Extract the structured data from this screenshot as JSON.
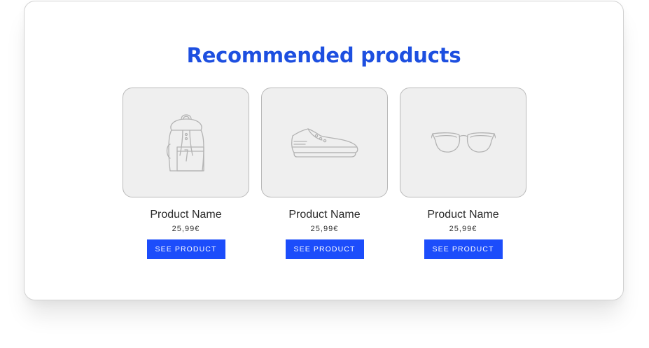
{
  "section": {
    "title": "Recommended products"
  },
  "products": [
    {
      "icon": "backpack-icon",
      "name": "Product Name",
      "price": "25,99€",
      "button_label": "SEE PRODUCT"
    },
    {
      "icon": "sneaker-icon",
      "name": "Product Name",
      "price": "25,99€",
      "button_label": "SEE PRODUCT"
    },
    {
      "icon": "glasses-icon",
      "name": "Product Name",
      "price": "25,99€",
      "button_label": "SEE PRODUCT"
    }
  ],
  "colors": {
    "accent": "#1c4dfb",
    "title": "#1d4fe0",
    "thumb_background": "#efefef"
  }
}
